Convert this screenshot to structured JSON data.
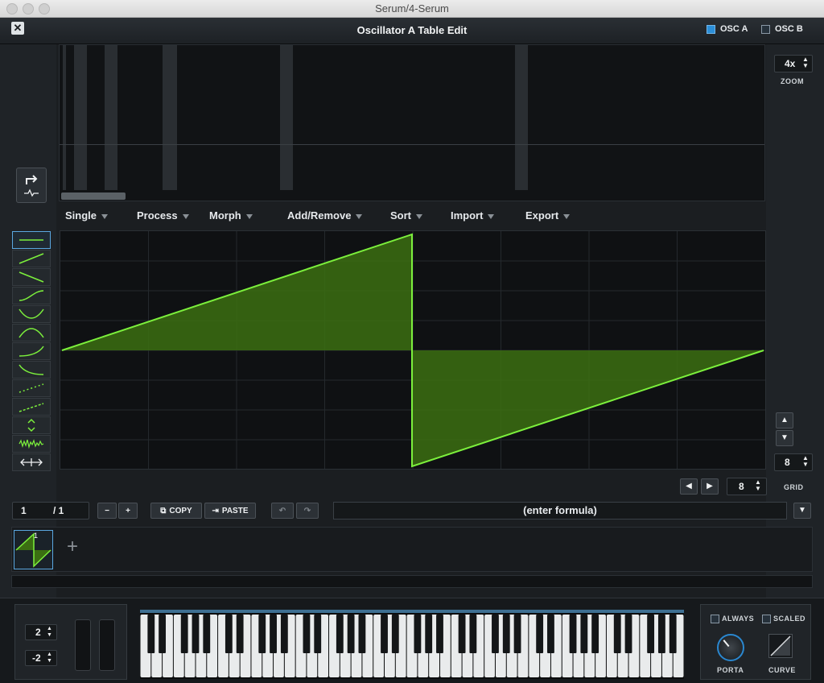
{
  "window": {
    "title": "Serum/4-Serum"
  },
  "header": {
    "title": "Oscillator A Table Edit",
    "close_glyph": "✕",
    "osc_a": "OSC A",
    "osc_b": "OSC B"
  },
  "menu": [
    "Single",
    "Process",
    "Morph",
    "Add/Remove",
    "Sort",
    "Import",
    "Export"
  ],
  "right": {
    "zoom_value": "4x",
    "zoom_label": "ZOOM",
    "grid_value": "8",
    "grid_label": "GRID",
    "grid_value_lower": "8"
  },
  "frame": {
    "current": "1",
    "total": "/ 1"
  },
  "buttons": {
    "minus": "−",
    "plus": "+",
    "copy": "COPY",
    "paste": "PASTE",
    "add_thumb": "+"
  },
  "formula": {
    "placeholder": "(enter formula)"
  },
  "thumbnail": {
    "index": "1"
  },
  "pitch": {
    "up": "2",
    "down": "-2"
  },
  "porta": {
    "always": "ALWAYS",
    "scaled": "SCALED",
    "porta_label": "PORTA",
    "curve_label": "CURVE"
  },
  "colors": {
    "accent_green": "#7cf03c",
    "fill_green": "#3b6e12",
    "accent_blue": "#5aa7e0"
  },
  "waveform": {
    "shape": "sawtooth",
    "peak": 1,
    "trough": -1
  }
}
